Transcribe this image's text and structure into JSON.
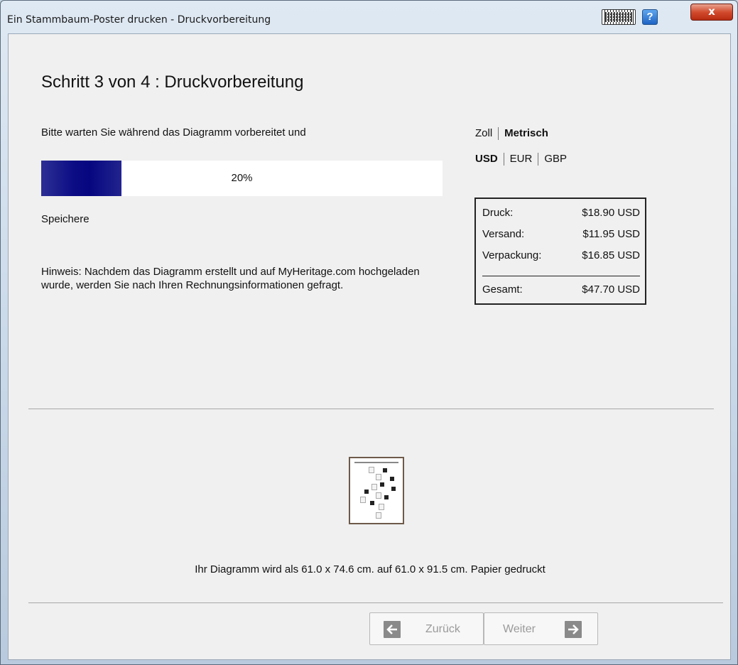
{
  "window": {
    "title": "Ein Stammbaum-Poster drucken - Druckvorbereitung",
    "close_glyph": "x",
    "help_glyph": "?"
  },
  "main": {
    "step_title": "Schritt 3 von 4 : Druckvorbereitung",
    "wait_text": "Bitte warten Sie während das Diagramm vorbereitet und",
    "progress": {
      "percent": 20,
      "label": "20%"
    },
    "status_text": "Speichere",
    "hint_text": "Hinweis: Nachdem das Diagramm erstellt und auf MyHeritage.com hochgeladen wurde, werden Sie nach Ihren Rechnungsinformationen gefragt."
  },
  "units": {
    "length": [
      {
        "label": "Zoll",
        "selected": false
      },
      {
        "label": "Metrisch",
        "selected": true
      }
    ],
    "currency": [
      {
        "label": "USD",
        "selected": true
      },
      {
        "label": "EUR",
        "selected": false
      },
      {
        "label": "GBP",
        "selected": false
      }
    ]
  },
  "pricing": {
    "rows": [
      {
        "label": "Druck:",
        "value": "$18.90 USD"
      },
      {
        "label": "Versand:",
        "value": "$11.95 USD"
      },
      {
        "label": "Verpackung:",
        "value": "$16.85 USD"
      }
    ],
    "total": {
      "label": "Gesamt:",
      "value": "$47.70 USD"
    }
  },
  "preview": {
    "size_note": "Ihr Diagramm wird als 61.0 x 74.6 cm. auf 61.0 x 91.5 cm. Papier gedruckt"
  },
  "footer": {
    "back_label": "Zurück",
    "next_label": "Weiter"
  }
}
